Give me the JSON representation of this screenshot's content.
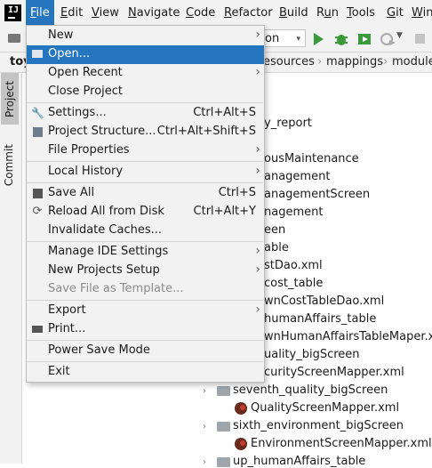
{
  "menubar": {
    "logo": "IJ",
    "items": [
      {
        "label": "File",
        "mnemonic": "F",
        "rest": "ile"
      },
      {
        "label": "Edit",
        "mnemonic": "E",
        "rest": "dit"
      },
      {
        "label": "View",
        "mnemonic": "V",
        "rest": "iew"
      },
      {
        "label": "Navigate",
        "mnemonic": "N",
        "rest": "avigate"
      },
      {
        "label": "Code",
        "mnemonic": "C",
        "rest": "ode"
      },
      {
        "label": "Refactor",
        "mnemonic": "R",
        "rest": "efactor"
      },
      {
        "label": "Build",
        "mnemonic": "B",
        "rest": "uild"
      },
      {
        "label": "Run",
        "mnemonic": "u",
        "pre": "R",
        "rest": "n"
      },
      {
        "label": "Tools",
        "mnemonic": "T",
        "rest": "ools"
      },
      {
        "label": "Git",
        "mnemonic": "G",
        "rest": "it"
      },
      {
        "label": "Win",
        "mnemonic": "W",
        "rest": "in"
      }
    ]
  },
  "toolbar": {
    "run_config_fragment": "on",
    "chevron": "▾"
  },
  "project_tab": "toy",
  "breadcrumb": [
    "esources",
    "mappings",
    "module"
  ],
  "side_tabs": {
    "project": "Project",
    "commit": "Commit"
  },
  "tree": {
    "partial": [
      "y_report",
      "ousMaintenance",
      "anagement",
      "anagementScreen",
      "nagement",
      "een",
      "able",
      "stDao.xml",
      "cost_table",
      "wnCostTableDao.xml",
      "humanAffairs_table",
      "wnHumanAffairsTableMaper.xml",
      "uality_bigScreen",
      "curityScreenMapper.xml"
    ],
    "full": [
      {
        "label": "seventh_quality_bigScreen",
        "type": "folder"
      },
      {
        "label": "QualityScreenMapper.xml",
        "type": "xml"
      },
      {
        "label": "sixth_environment_bigScreen",
        "type": "folder"
      },
      {
        "label": "EnvironmentScreenMapper.xml",
        "type": "xml"
      },
      {
        "label": "up_humanAffairs_table",
        "type": "folder"
      }
    ]
  },
  "file_menu": {
    "items": [
      {
        "label": "New",
        "shortcut": "",
        "submenu": true
      },
      {
        "label": "Open...",
        "shortcut": "",
        "highlighted": true
      },
      {
        "label": "Open Recent",
        "shortcut": "",
        "submenu": true
      },
      {
        "label": "Close Project",
        "shortcut": ""
      },
      {
        "label": "Settings...",
        "shortcut": "Ctrl+Alt+S",
        "icon": "wrench-icon"
      },
      {
        "label": "Project Structure...",
        "shortcut": "Ctrl+Alt+Shift+S",
        "icon": "project-structure-icon"
      },
      {
        "label": "File Properties",
        "shortcut": "",
        "submenu": true
      },
      {
        "label": "Local History",
        "shortcut": "",
        "submenu": true
      },
      {
        "label": "Save All",
        "shortcut": "Ctrl+S",
        "icon": "save-icon"
      },
      {
        "label": "Reload All from Disk",
        "shortcut": "Ctrl+Alt+Y",
        "icon": "reload-icon"
      },
      {
        "label": "Invalidate Caches...",
        "shortcut": ""
      },
      {
        "label": "Manage IDE Settings",
        "shortcut": "",
        "submenu": true
      },
      {
        "label": "New Projects Setup",
        "shortcut": "",
        "submenu": true
      },
      {
        "label": "Save File as Template...",
        "shortcut": "",
        "disabled": true
      },
      {
        "label": "Export",
        "shortcut": "",
        "submenu": true
      },
      {
        "label": "Print...",
        "shortcut": "",
        "icon": "print-icon"
      },
      {
        "label": "Power Save Mode",
        "shortcut": ""
      },
      {
        "label": "Exit",
        "shortcut": ""
      }
    ]
  },
  "colors": {
    "accent": "#2675bf",
    "menu_bg": "#f2f2f2",
    "run_green": "#3b9a3b"
  }
}
